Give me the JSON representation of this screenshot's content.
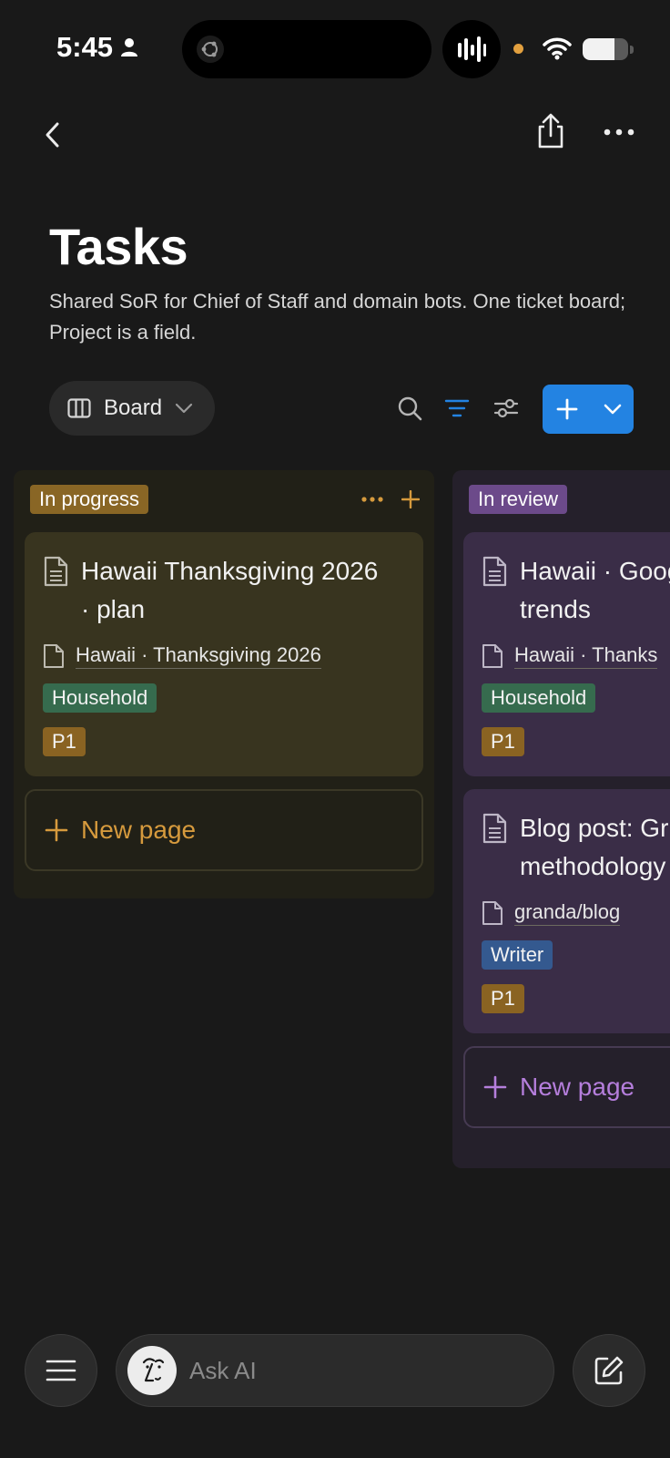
{
  "status_bar": {
    "time": "5:45",
    "battery_level": 0.7
  },
  "header": {
    "title": "Tasks",
    "description": "Shared SoR for Chief of Staff and domain bots. One ticket board; Project is a field."
  },
  "toolbar": {
    "view_label": "Board",
    "accent_color": "#2383e2"
  },
  "board": {
    "columns": [
      {
        "name": "In progress",
        "color": "#896625",
        "cards": [
          {
            "title": "Hawaii Thanksgiving 2026 · plan",
            "title_line1": "Hawaii Thanksgiving 2026",
            "title_line2": "· plan",
            "relation": "Hawaii · Thanksgiving 2026",
            "tag": "Household",
            "priority": "P1"
          }
        ],
        "new_page_label": "New page"
      },
      {
        "name": "In review",
        "color": "#6c4a8a",
        "cards": [
          {
            "title_line1": "Hawaii · Goog",
            "title_line2": "trends",
            "relation": "Hawaii · Thanks",
            "tag": "Household",
            "priority": "P1"
          },
          {
            "title_line1": "Blog post: Gr",
            "title_line2": "methodology",
            "relation": "granda/blog",
            "tag": "Writer",
            "priority": "P1"
          }
        ],
        "new_page_label": "New page"
      }
    ]
  },
  "bottom_bar": {
    "ask_ai_placeholder": "Ask AI"
  }
}
